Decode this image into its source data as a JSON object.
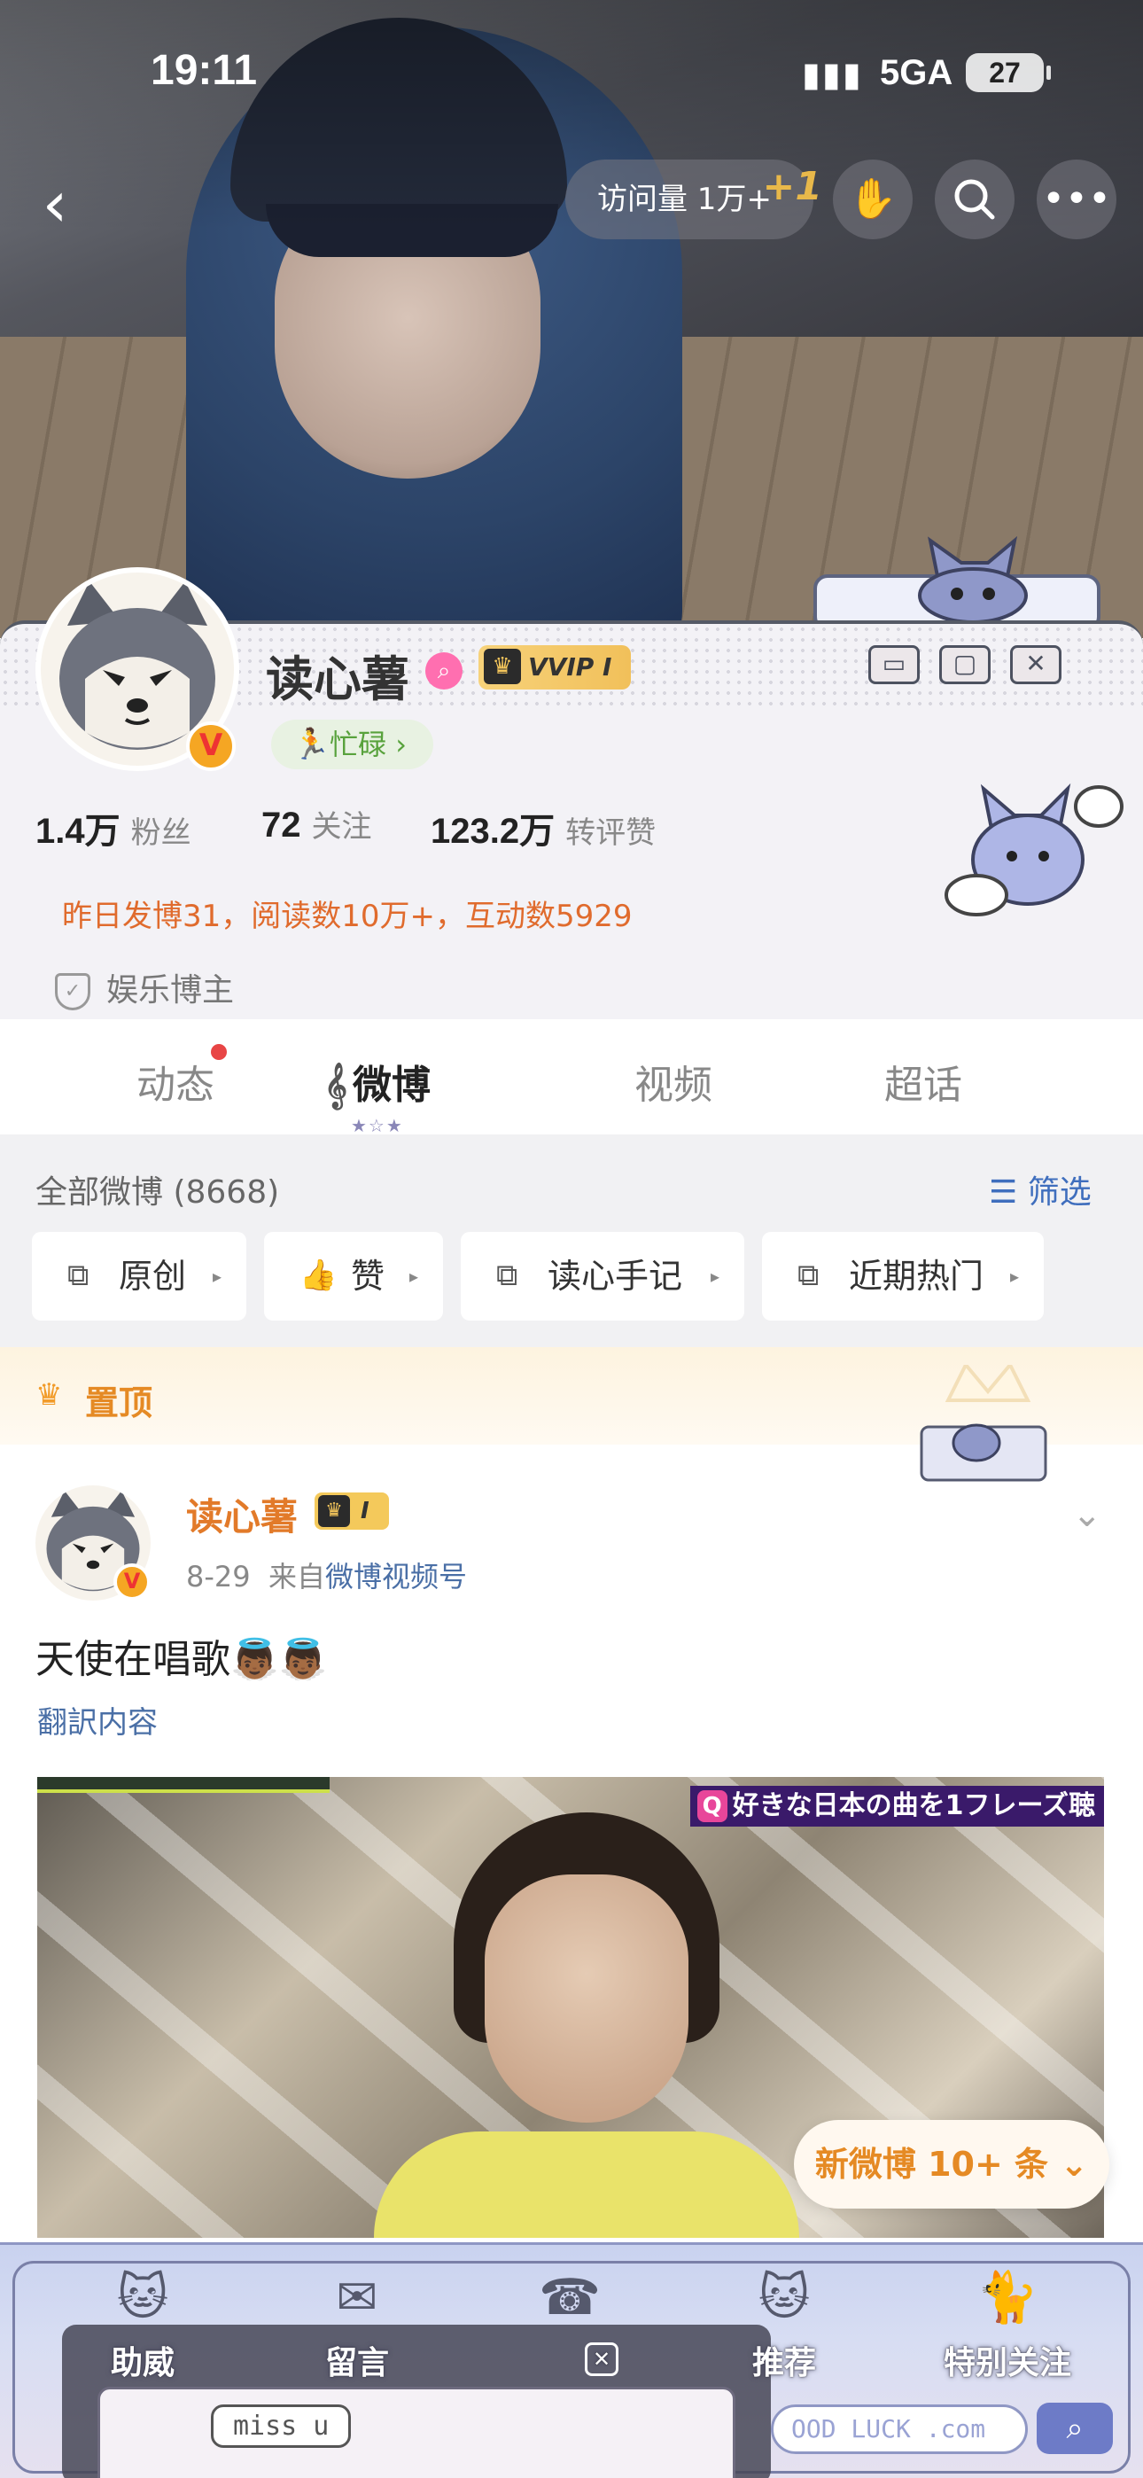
{
  "status_bar": {
    "time": "19:11",
    "network": "5GA",
    "battery": "27",
    "signal_icon": "signal-bars-icon"
  },
  "top_nav": {
    "visits_label": "访问量 1万+",
    "visits_plus": "+1",
    "back_icon": "chevron-left-icon",
    "actions": [
      "hand-wave-icon",
      "search-icon",
      "more-icon"
    ]
  },
  "profile": {
    "name": "读心薯",
    "vip_label": "VVIP",
    "vip_level": "I",
    "status_chip": "忙碌",
    "stats": [
      {
        "value": "1.4万",
        "label": "粉丝"
      },
      {
        "value": "72",
        "label": "关注"
      },
      {
        "value": "123.2万",
        "label": "转评赞"
      }
    ],
    "yesterday": "昨日发博31，阅读数10万+，互动数5929",
    "category": "娱乐博主",
    "window_buttons": [
      "minimize-icon",
      "maximize-icon",
      "close-icon"
    ]
  },
  "tabs": [
    {
      "label": "动态",
      "badge": true
    },
    {
      "label": "微博",
      "active": true
    },
    {
      "label": "视频"
    },
    {
      "label": "超话"
    }
  ],
  "feed_filter": {
    "total_label": "全部微博 (8668)",
    "filter_label": "筛选",
    "chips": [
      "原创",
      "赞",
      "读心手记",
      "近期热门"
    ]
  },
  "pinned": {
    "label": "置顶"
  },
  "post": {
    "author": "读心薯",
    "badge_level": "I",
    "date": "8-29",
    "from_label": "来自",
    "source": "微博视频号",
    "text": "天使在唱歌👼🏾👼🏾",
    "translate": "翻訳内容",
    "video_caption": "好きな日本の曲を1フレーズ聴"
  },
  "new_posts_label": "新微博 10+ 条",
  "bottom_bar": {
    "tabs": [
      "助威",
      "留言",
      "",
      "推荐",
      "特别关注"
    ],
    "sticker_text": "miss u",
    "url_text": "OOD LUCK .com"
  }
}
